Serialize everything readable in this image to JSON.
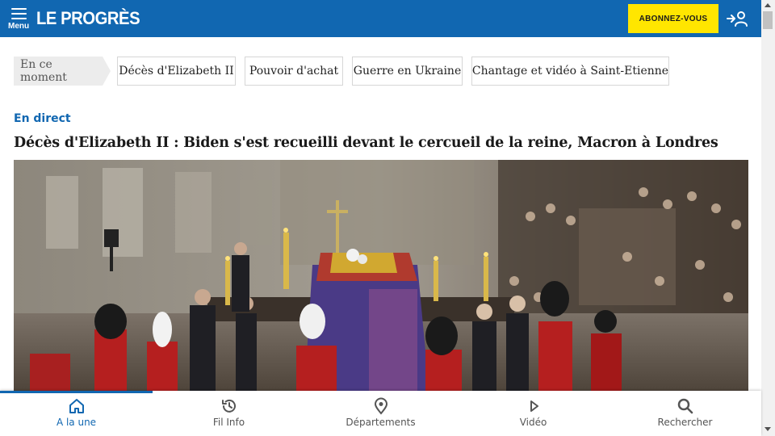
{
  "header": {
    "menu_label": "Menu",
    "logo_text": "LE PROGRÈS",
    "subscribe_label": "ABONNEZ-VOUS",
    "brand_color": "#1167b1",
    "subscribe_color": "#ffe600"
  },
  "topics": {
    "now_label": "En ce moment",
    "items": [
      "Décès d'Elizabeth II",
      "Pouvoir d'achat",
      "Guerre en Ukraine",
      "Chantage et vidéo à Saint-Etienne"
    ]
  },
  "article": {
    "live_label": "En direct",
    "headline": "Décès d'Elizabeth II : Biden s'est recueilli devant le cercueil de la reine, Macron à Londres"
  },
  "bottom_nav": {
    "items": [
      {
        "label": "A la une",
        "icon": "home-icon",
        "active": true
      },
      {
        "label": "Fil Info",
        "icon": "history-icon",
        "active": false
      },
      {
        "label": "Départements",
        "icon": "location-pin-icon",
        "active": false
      },
      {
        "label": "Vidéo",
        "icon": "play-icon",
        "active": false
      },
      {
        "label": "Rechercher",
        "icon": "search-icon",
        "active": false
      }
    ]
  }
}
